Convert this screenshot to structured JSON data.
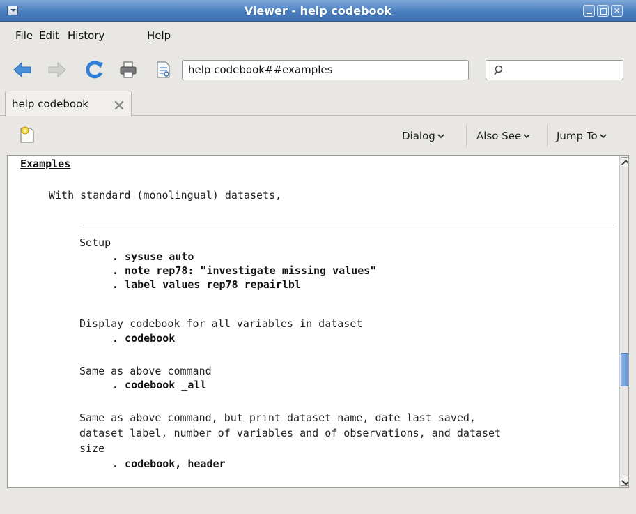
{
  "window": {
    "title": "Viewer - help codebook"
  },
  "menubar": {
    "items": [
      {
        "pre": "",
        "accel": "F",
        "post": "ile"
      },
      {
        "pre": "",
        "accel": "E",
        "post": "dit"
      },
      {
        "pre": "Hi",
        "accel": "s",
        "post": "tory"
      },
      {
        "pre": "",
        "accel": "H",
        "post": "elp"
      }
    ]
  },
  "toolbar": {
    "address_value": "help codebook##examples",
    "search_value": ""
  },
  "tabs": [
    {
      "label": "help codebook"
    }
  ],
  "viewer_toolbar": {
    "dialog_label": "Dialog",
    "also_see_label": "Also See",
    "jump_to_label": "Jump To"
  },
  "content": {
    "heading": "Examples",
    "intro": "With standard (monolingual) datasets,",
    "sections": [
      {
        "desc": [
          "Setup"
        ],
        "commands": [
          ". sysuse auto",
          ". note rep78: \"investigate missing values\"",
          ". label values rep78 repairlbl"
        ]
      },
      {
        "desc": [
          "Display codebook for all variables in dataset"
        ],
        "commands": [
          ". codebook"
        ]
      },
      {
        "desc": [
          "Same as above command"
        ],
        "commands": [
          ". codebook _all"
        ]
      },
      {
        "desc": [
          "Same as above command, but print dataset name, date last saved,",
          "dataset label, number of variables and of observations, and dataset",
          "size"
        ],
        "commands": [
          ". codebook, header"
        ]
      }
    ]
  },
  "colors": {
    "titlebar": "#4a7fc0",
    "scroll_thumb": "#5d8fd0",
    "back_arrow": "#4a90d9",
    "reload": "#2f7fd6"
  },
  "icons": [
    "window-menu-icon",
    "minimize-icon",
    "maximize-icon",
    "close-icon",
    "back-icon",
    "forward-icon",
    "reload-icon",
    "print-icon",
    "document-icon",
    "search-icon",
    "tab-close-icon",
    "new-viewer-icon",
    "chevron-down-icon"
  ]
}
